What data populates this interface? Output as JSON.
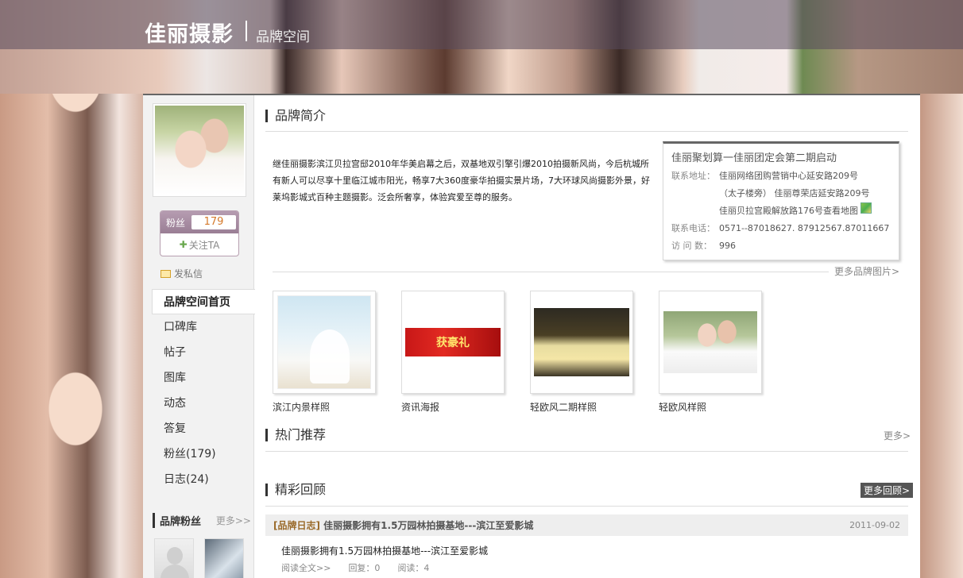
{
  "header": {
    "logo": "佳丽摄影",
    "subtitle": "品牌空间"
  },
  "sidebar": {
    "fans_label": "粉丝",
    "fans_count": "179",
    "follow": "关注TA",
    "message": "发私信",
    "nav": [
      {
        "label": "品牌空间首页",
        "active": true
      },
      {
        "label": "口碑库"
      },
      {
        "label": "帖子"
      },
      {
        "label": "图库"
      },
      {
        "label": "动态"
      },
      {
        "label": "答复"
      },
      {
        "label": "粉丝(179)"
      },
      {
        "label": "日志(24)"
      }
    ],
    "fans_section_title": "品牌粉丝",
    "fans_section_more": "更多>>"
  },
  "intro": {
    "title": "品牌简介",
    "text": "继佳丽摄影滨江贝拉宫邸2010年华美启幕之后，双基地双引擎引爆2010拍摄新风尚，今后杭城所有新人可以尽享十里临江城市阳光，畅享7大360度豪华拍摄实景片场，7大环球风尚摄影外景，好莱坞影城式百种主题摄影。泛会所奢享，体验宾爱至尊的服务。"
  },
  "info": {
    "title": "佳丽聚划算一佳丽团定会第二期启动",
    "address_label": "联系地址：",
    "address1": "佳丽网络团购营销中心延安路209号",
    "address2": "（太子楼旁） 佳丽尊荣店延安路209号",
    "address3": "佳丽贝拉宫殿解放路176号查看地图",
    "phone_label": "联系电话：",
    "phone": "0571--87018627. 87912567.87011667",
    "visits_label": "访 问 数：",
    "visits": "996"
  },
  "gallery": {
    "more": "更多品牌图片>",
    "items": [
      {
        "caption": "滨江内景样照"
      },
      {
        "caption": "资讯海报",
        "banner": "获豪礼"
      },
      {
        "caption": "轻欧风二期样照"
      },
      {
        "caption": "轻欧风样照"
      }
    ]
  },
  "hot": {
    "title": "热门推荐",
    "more": "更多>"
  },
  "review": {
    "title": "精彩回顾",
    "more": "更多回顾>",
    "item": {
      "category": "[品牌日志]",
      "title": "佳丽摄影拥有1.5万园林拍摄基地---滨江至爱影城",
      "date": "2011-09-02",
      "summary": "佳丽摄影拥有1.5万园林拍摄基地---滨江至爱影城",
      "read_more": "阅读全文>>",
      "replies": "回复：0",
      "reads": "阅读：4"
    }
  }
}
